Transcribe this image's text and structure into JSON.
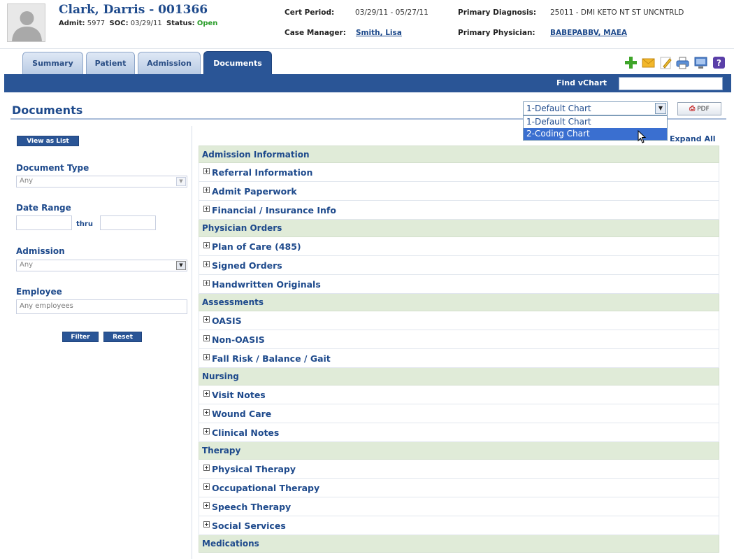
{
  "patient": {
    "name": "Clark, Darris - 001366",
    "admit_label": "Admit:",
    "admit_value": "5977",
    "soc_label": "SOC:",
    "soc_value": "03/29/11",
    "status_label": "Status:",
    "status_value": "Open"
  },
  "header": {
    "cert_period_label": "Cert Period:",
    "cert_period_value": "03/29/11 - 05/27/11",
    "case_manager_label": "Case Manager:",
    "case_manager_value": "Smith, Lisa",
    "primary_dx_label": "Primary Diagnosis:",
    "primary_dx_value": "25011 - DMI KETO NT ST UNCNTRLD",
    "primary_phys_label": "Primary Physician:",
    "primary_phys_value": "BABEPABBV, MAEA"
  },
  "tabs": [
    {
      "label": "Summary"
    },
    {
      "label": "Patient"
    },
    {
      "label": "Admission"
    },
    {
      "label": "Documents"
    }
  ],
  "toolbar": {
    "icons": [
      "add-icon",
      "mail-icon",
      "edit-icon",
      "print-icon",
      "monitor-icon",
      "help-icon"
    ],
    "find_label": "Find vChart"
  },
  "page": {
    "title": "Documents",
    "chart_select_value": "1-Default Chart",
    "chart_options": [
      "1-Default Chart",
      "2-Coding Chart"
    ],
    "pdf_label": "PDF",
    "expand_all": "Expand All"
  },
  "filters": {
    "view_as_list": "View as List",
    "document_type_label": "Document Type",
    "document_type_value": "Any",
    "date_range_label": "Date Range",
    "thru_label": "thru",
    "admission_label": "Admission",
    "admission_value": "Any",
    "employee_label": "Employee",
    "employee_value": "Any employees",
    "filter_button": "Filter",
    "reset_button": "Reset"
  },
  "sections": [
    {
      "title": "Admission Information",
      "items": [
        "Referral Information",
        "Admit Paperwork",
        "Financial / Insurance Info"
      ]
    },
    {
      "title": "Physician Orders",
      "items": [
        "Plan of Care (485)",
        "Signed Orders",
        "Handwritten Originals"
      ]
    },
    {
      "title": "Assessments",
      "items": [
        "OASIS",
        "Non-OASIS",
        "Fall Risk / Balance / Gait"
      ]
    },
    {
      "title": "Nursing",
      "items": [
        "Visit Notes",
        "Wound Care",
        "Clinical Notes"
      ]
    },
    {
      "title": "Therapy",
      "items": [
        "Physical Therapy",
        "Occupational Therapy",
        "Speech Therapy",
        "Social Services"
      ]
    },
    {
      "title": "Medications",
      "items": []
    }
  ]
}
